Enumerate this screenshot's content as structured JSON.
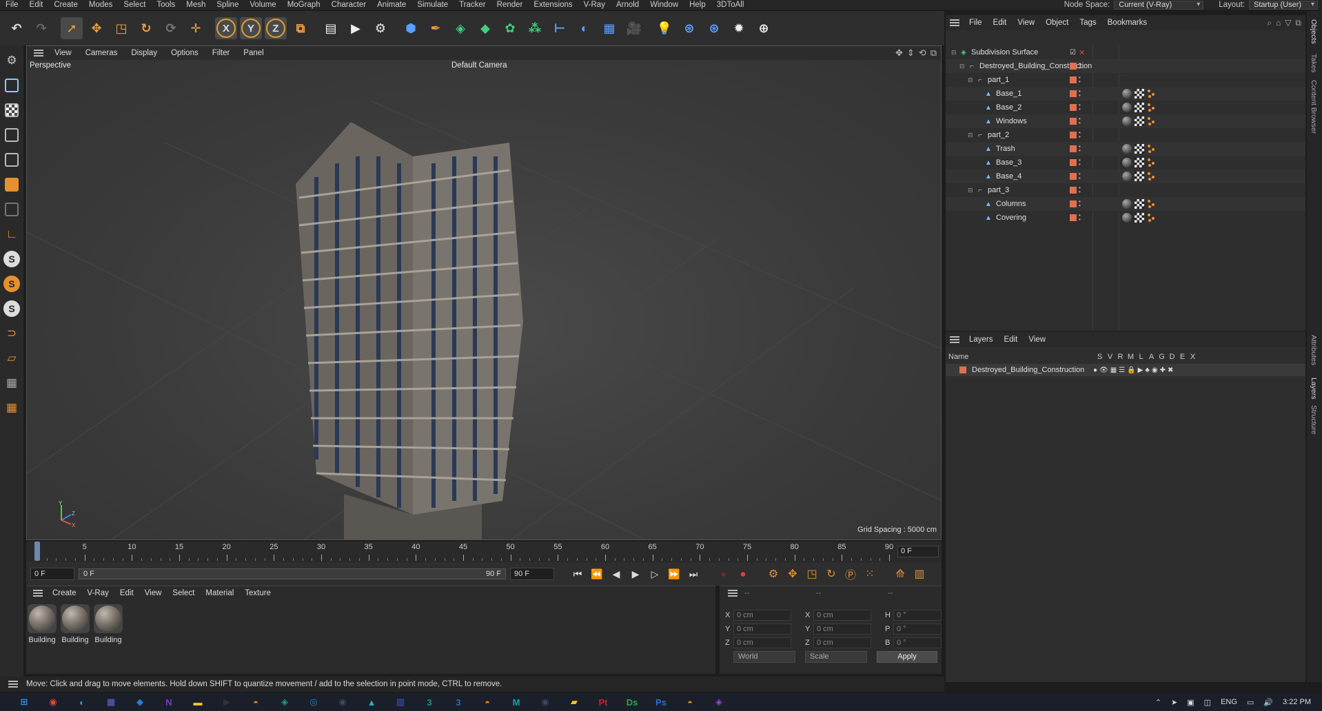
{
  "menubar": {
    "items": [
      "File",
      "Edit",
      "Create",
      "Modes",
      "Select",
      "Tools",
      "Mesh",
      "Spline",
      "Volume",
      "MoGraph",
      "Character",
      "Animate",
      "Simulate",
      "Tracker",
      "Render",
      "Extensions",
      "V-Ray",
      "Arnold",
      "Window",
      "Help",
      "3DToAll"
    ],
    "node_space_label": "Node Space:",
    "node_space_value": "Current (V-Ray)",
    "layout_label": "Layout:",
    "layout_value": "Startup (User)"
  },
  "toolbar": {
    "icons": [
      "undo-icon",
      "redo-icon",
      "select-icon",
      "move-icon",
      "scale-icon",
      "rotate-icon",
      "recent-tool-icon",
      "add-icon",
      "x-axis-icon",
      "y-axis-icon",
      "z-axis-icon",
      "coordinate-system-icon",
      "render-region-icon",
      "render-view-icon",
      "render-settings-icon",
      "cube-icon",
      "pen-icon",
      "subdivision-icon",
      "extrude-icon",
      "cloner-icon",
      "voxel-icon",
      "deformer-icon",
      "environment-icon",
      "floor-icon",
      "camera-icon",
      "light-icon",
      "python-icon",
      "python2-icon",
      "gear-icon",
      "sphere-grid-icon"
    ],
    "axis_labels": [
      "X",
      "Y",
      "Z"
    ]
  },
  "viewport": {
    "menu": [
      "View",
      "Cameras",
      "Display",
      "Options",
      "Filter",
      "Panel"
    ],
    "projection": "Perspective",
    "camera": "Default Camera",
    "grid_spacing": "Grid Spacing : 5000 cm",
    "axis_labels": [
      "Y",
      "Z",
      "X"
    ]
  },
  "timeline": {
    "ticks": [
      "0",
      "5",
      "10",
      "15",
      "20",
      "25",
      "30",
      "35",
      "40",
      "45",
      "50",
      "55",
      "60",
      "65",
      "70",
      "75",
      "80",
      "85",
      "90"
    ],
    "current_frame": "0 F"
  },
  "transport": {
    "start": "0 F",
    "range_start": "0 F",
    "range_end": "90 F",
    "end": "90 F"
  },
  "materials": {
    "menu": [
      "Create",
      "V-Ray",
      "Edit",
      "View",
      "Select",
      "Material",
      "Texture"
    ],
    "items": [
      "Building",
      "Building",
      "Building"
    ]
  },
  "coords": {
    "headers": [
      "--",
      "--",
      "--"
    ],
    "rows": [
      {
        "l1": "X",
        "v1": "0 cm",
        "l2": "X",
        "v2": "0 cm",
        "l3": "H",
        "v3": "0 °"
      },
      {
        "l1": "Y",
        "v1": "0 cm",
        "l2": "Y",
        "v2": "0 cm",
        "l3": "P",
        "v3": "0 °"
      },
      {
        "l1": "Z",
        "v1": "0 cm",
        "l2": "Z",
        "v2": "0 cm",
        "l3": "B",
        "v3": "0 °"
      }
    ],
    "space": "World",
    "mode": "Scale",
    "apply": "Apply"
  },
  "status": "Move: Click and drag to move elements. Hold down SHIFT to quantize movement / add to the selection in point mode, CTRL to remove.",
  "objects": {
    "menu": [
      "File",
      "Edit",
      "View",
      "Object",
      "Tags",
      "Bookmarks"
    ],
    "rows": [
      {
        "name": "Subdivision Surface",
        "kind": "sub",
        "depth": 0,
        "tags": false
      },
      {
        "name": "Destroyed_Building_Construction",
        "kind": "null",
        "depth": 1,
        "tags": false
      },
      {
        "name": "part_1",
        "kind": "null",
        "depth": 2,
        "tags": false
      },
      {
        "name": "Base_1",
        "kind": "poly",
        "depth": 3,
        "tags": true
      },
      {
        "name": "Base_2",
        "kind": "poly",
        "depth": 3,
        "tags": true
      },
      {
        "name": "Windows",
        "kind": "poly",
        "depth": 3,
        "tags": true
      },
      {
        "name": "part_2",
        "kind": "null",
        "depth": 2,
        "tags": false
      },
      {
        "name": "Trash",
        "kind": "poly",
        "depth": 3,
        "tags": true
      },
      {
        "name": "Base_3",
        "kind": "poly",
        "depth": 3,
        "tags": true
      },
      {
        "name": "Base_4",
        "kind": "poly",
        "depth": 3,
        "tags": true
      },
      {
        "name": "part_3",
        "kind": "null",
        "depth": 2,
        "tags": false
      },
      {
        "name": "Columns",
        "kind": "poly",
        "depth": 3,
        "tags": true
      },
      {
        "name": "Covering",
        "kind": "poly",
        "depth": 3,
        "tags": true
      }
    ]
  },
  "layers": {
    "menu": [
      "Layers",
      "Edit",
      "View"
    ],
    "columns": [
      "Name",
      "S",
      "V",
      "R",
      "M",
      "L",
      "A",
      "G",
      "D",
      "E",
      "X"
    ],
    "row_name": "Destroyed_Building_Construction",
    "row_color": "#e07050"
  },
  "vtabs": [
    "Objects",
    "Takes",
    "Content Browser",
    "Attributes",
    "Layers",
    "Structure"
  ],
  "taskbar": {
    "lang": "ENG",
    "time": "3:22 PM",
    "apps": [
      "windows-start-icon",
      "chrome-icon",
      "edge-icon",
      "calculator-icon",
      "vscode-icon",
      "onenote-icon",
      "explorer-icon",
      "terminal-icon",
      "blender-icon",
      "app-icon",
      "app2-icon",
      "cinema4d-icon",
      "app3-icon",
      "app4-icon",
      "3dsmax-icon",
      "3dsmax2-icon",
      "blender2-icon",
      "maya-icon",
      "c4d2-icon",
      "folder-icon",
      "painter-icon",
      "designer-icon",
      "photoshop-icon",
      "blender3-icon",
      "visualstudio-icon"
    ]
  },
  "colors": {
    "accent": "#e89030",
    "tag_red": "#e07050",
    "selected": "#4a4a4a"
  }
}
